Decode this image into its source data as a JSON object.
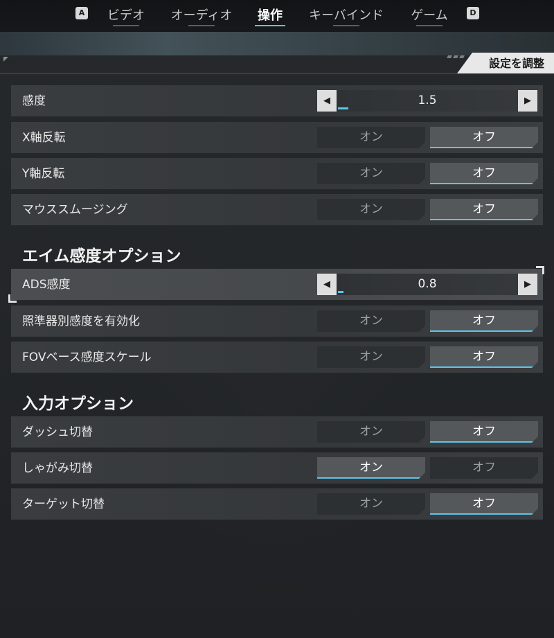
{
  "nav": {
    "prev_key": "A",
    "next_key": "D",
    "tabs": [
      {
        "label": "ビデオ"
      },
      {
        "label": "オーディオ"
      },
      {
        "label": "操作",
        "active": true
      },
      {
        "label": "キーバインド"
      },
      {
        "label": "ゲーム"
      }
    ]
  },
  "panel": {
    "adjust_label": "設定を調整"
  },
  "common": {
    "on": "オン",
    "off": "オフ"
  },
  "rows": [
    {
      "label": "感度",
      "type": "slider",
      "value": "1.5",
      "fill_fraction": 0.06
    },
    {
      "label": "X軸反転",
      "type": "toggle",
      "selected": "off"
    },
    {
      "label": "Y軸反転",
      "type": "toggle",
      "selected": "off"
    },
    {
      "label": "マウススムージング",
      "type": "toggle",
      "selected": "off"
    }
  ],
  "section_aim": {
    "title": "エイム感度オプション",
    "rows": [
      {
        "label": "ADS感度",
        "type": "slider",
        "value": "0.8",
        "fill_fraction": 0.03,
        "focused": true
      },
      {
        "label": "照準器別感度を有効化",
        "type": "toggle",
        "selected": "off"
      },
      {
        "label": "FOVベース感度スケール",
        "type": "toggle",
        "selected": "off"
      }
    ]
  },
  "section_input": {
    "title": "入力オプション",
    "rows": [
      {
        "label": "ダッシュ切替",
        "type": "toggle",
        "selected": "off"
      },
      {
        "label": "しゃがみ切替",
        "type": "toggle",
        "selected": "on"
      },
      {
        "label": "ターゲット切替",
        "type": "toggle",
        "selected": "off"
      }
    ]
  },
  "colors": {
    "accent": "#5ec4e8",
    "panel": "#2b2e31",
    "selected_button": "#55585b"
  }
}
